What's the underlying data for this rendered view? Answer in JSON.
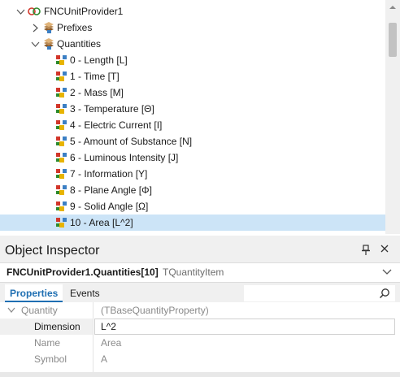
{
  "tree": {
    "root": {
      "label": "FNCUnitProvider1"
    },
    "prefixes": {
      "label": "Prefixes"
    },
    "quantities": {
      "label": "Quantities",
      "items": [
        {
          "label": "0 - Length [L]"
        },
        {
          "label": "1 - Time [T]"
        },
        {
          "label": "2 - Mass [M]"
        },
        {
          "label": "3 - Temperature [Θ]"
        },
        {
          "label": "4 - Electric Current [I]"
        },
        {
          "label": "5 - Amount of Substance [N]"
        },
        {
          "label": "6 - Luminous Intensity [J]"
        },
        {
          "label": "7 - Information [Y]"
        },
        {
          "label": "8 - Plane Angle [Φ]"
        },
        {
          "label": "9 - Solid Angle [Ω]"
        },
        {
          "label": "10 - Area [L^2]"
        }
      ],
      "selected_index": 10
    }
  },
  "inspector": {
    "title": "Object Inspector",
    "object_name": "FNCUnitProvider1.Quantities[10]",
    "object_type": "TQuantityItem",
    "tabs": [
      {
        "label": "Properties",
        "active": true
      },
      {
        "label": "Events",
        "active": false
      }
    ],
    "properties": [
      {
        "name": "Quantity",
        "value": "(TBaseQuantityProperty)"
      },
      {
        "name": "Dimension",
        "value": "L^2"
      },
      {
        "name": "Name",
        "value": "Area"
      },
      {
        "name": "Symbol",
        "value": "A"
      }
    ]
  },
  "colors": {
    "selection": "#cce4f7",
    "accent": "#1f6fb2",
    "panel": "#f0f0f0"
  }
}
